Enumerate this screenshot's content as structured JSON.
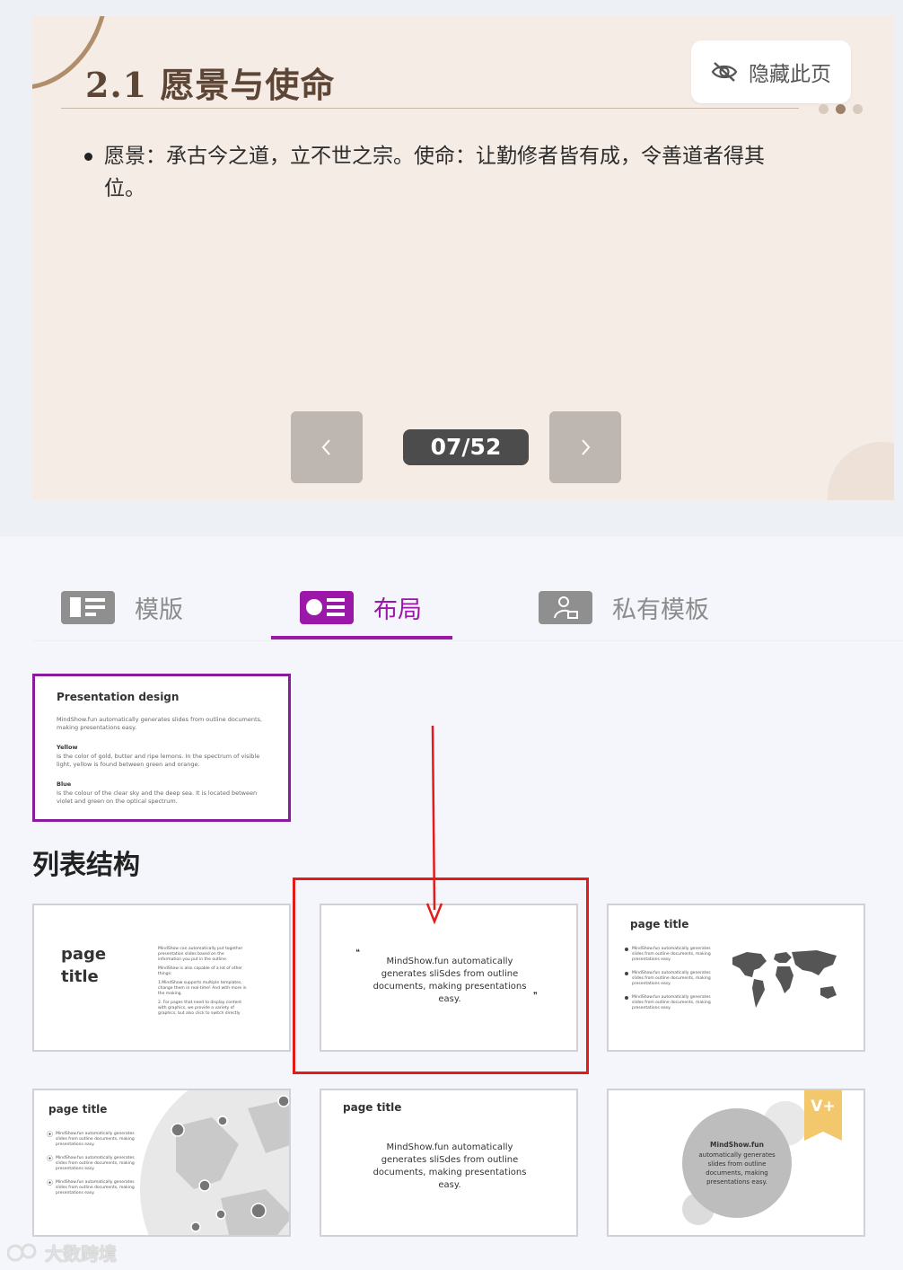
{
  "slide": {
    "title": "2.1 愿景与使命",
    "bullet": "愿景：承古今之道，立不世之宗。使命：让勤修者皆有成，令善道者得其位。",
    "hide_label": "隐藏此页",
    "page_counter": "07/52",
    "colors": {
      "bg": "#f5ece6",
      "title": "#5e4636",
      "accent": "#b08e6b"
    }
  },
  "tabs": [
    {
      "label": "模版",
      "icon": "template-list-icon",
      "active": false
    },
    {
      "label": "布局",
      "icon": "layout-card-icon",
      "active": true
    },
    {
      "label": "私有模板",
      "icon": "user-lock-icon",
      "active": false
    }
  ],
  "accent_color": "#9a17a8",
  "selected_layout": {
    "title": "Presentation design",
    "intro": "MindShow.fun automatically generates slides from outline documents, making presentations easy.",
    "item1_head": "Yellow",
    "item1_body": "Is the color of gold, butter and ripe lemons. In the spectrum of visible light, yellow is found between green and orange.",
    "item2_head": "Blue",
    "item2_body": "Is the colour of the clear sky and the deep sea. It is located between violet and green on the optical spectrum."
  },
  "section_title": "列表结构",
  "layouts": {
    "t1": {
      "title": "page title",
      "p1": "MindShow can automatically put together presentation slides based on the information you put in the outline.",
      "p2": "MindShow is also capable of a lot of other things:",
      "p3": "1.MindShow supports multiple templates, change them in real-time! And with more in the making.",
      "p4": "2. For pages that need to display content with graphics, we provide a variety of graphics, but also click to switch directly"
    },
    "t2": {
      "open_quote": "❝",
      "quote": "MindShow.fun automatically generates sliSdes from outline documents, making presentations easy.",
      "close_quote": "❞"
    },
    "t3": {
      "title": "page title",
      "items": [
        "MindShow.fun automatically generates slides from outline documents, making presentations easy.",
        "MindShow.fun automatically generates slides from outline documents, making presentations easy.",
        "MindShow.fun automatically generates slides from outline documents, making presentations easy."
      ]
    },
    "t4": {
      "title": "page title",
      "items": [
        "MindShow.fun automatically generates slides from outline documents, making presentations easy.",
        "MindShow.fun automatically generates slides from outline documents, making presentations easy.",
        "MindShow.fun automatically generates slides from outline documents, making presentations easy."
      ]
    },
    "t5": {
      "title": "page title",
      "body": "MindShow.fun automatically generates sliSdes from outline documents, making presentations easy."
    },
    "t6": {
      "circle_title": "MindShow.fun",
      "circle_text": "automatically generates slides from outline documents, making presentations easy.",
      "badge": "V+"
    }
  },
  "watermark": "大数跨境"
}
